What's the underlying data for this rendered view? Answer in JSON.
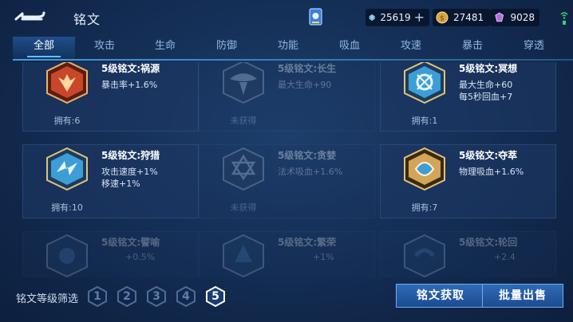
{
  "header": {
    "title": "铭文",
    "back_icon": "back-arrow-icon",
    "currencies": [
      {
        "name": "diamond",
        "value": "25619",
        "icon": "diamond-icon"
      },
      {
        "name": "gold",
        "value": "27481",
        "icon": "gold-coin-icon"
      },
      {
        "name": "gem",
        "value": "9028",
        "icon": "gem-icon"
      }
    ]
  },
  "tabs": [
    {
      "label": "全部",
      "active": true
    },
    {
      "label": "攻击"
    },
    {
      "label": "生命"
    },
    {
      "label": "防御"
    },
    {
      "label": "功能"
    },
    {
      "label": "吸血"
    },
    {
      "label": "攻速"
    },
    {
      "label": "暴击"
    },
    {
      "label": "穿透"
    }
  ],
  "cards": [
    {
      "name": "5级铭文:祸源",
      "attr1": "暴击率+1.6%",
      "attr2": "",
      "owned": "拥有:6",
      "state": "owned",
      "color": "#c8472a"
    },
    {
      "name": "5级铭文:长生",
      "attr1": "最大生命+90",
      "attr2": "",
      "owned": "未获得",
      "state": "locked",
      "color": "#7aa0c4"
    },
    {
      "name": "5级铭文:冥想",
      "attr1": "最大生命+60",
      "attr2": "每5秒回血+7",
      "owned": "拥有:1",
      "state": "owned",
      "color": "#3d9ed6"
    },
    {
      "name": "5级铭文:狩猎",
      "attr1": "攻击速度+1%",
      "attr2": "移速+1%",
      "owned": "拥有:10",
      "state": "owned",
      "color": "#3d9ed6"
    },
    {
      "name": "5级铭文:贪婪",
      "attr1": "法术吸血+1.6%",
      "attr2": "",
      "owned": "未获得",
      "state": "locked",
      "color": "#7aa0c4"
    },
    {
      "name": "5级铭文:夺萃",
      "attr1": "物理吸血+1.6%",
      "attr2": "",
      "owned": "拥有:7",
      "state": "owned",
      "color": "#d2a55a"
    },
    {
      "name": "5级铭文:譬喻",
      "attr1": "+0.5%",
      "attr2": "",
      "owned": "",
      "state": "fade",
      "color": "#4b8ac0"
    },
    {
      "name": "5级铭文:繁荣",
      "attr1": "+1%",
      "attr2": "",
      "owned": "",
      "state": "fade",
      "color": "#4b8ac0"
    },
    {
      "name": "5级铭文:轮回",
      "attr1": "+2.4",
      "attr2": "",
      "owned": "",
      "state": "fade",
      "color": "#4b8ac0"
    }
  ],
  "filter": {
    "label": "铭文等级筛选",
    "levels": [
      "1",
      "2",
      "3",
      "4",
      "5"
    ],
    "active_level": "5"
  },
  "buttons": {
    "acquire": "铭文获取",
    "bulk_sell": "批量出售"
  }
}
